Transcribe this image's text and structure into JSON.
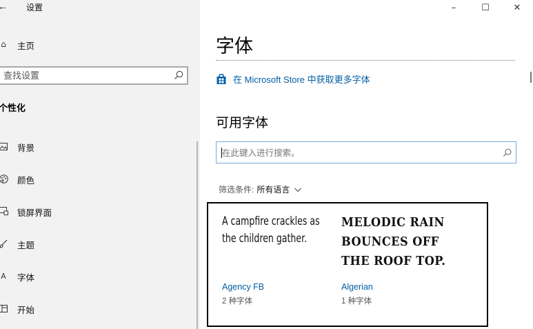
{
  "window": {
    "title": "设置",
    "controls": {
      "minimize": "–",
      "maximize": "☐",
      "close": "✕"
    }
  },
  "sidebar": {
    "home_label": "主页",
    "search_placeholder": "查找设置",
    "section_header": "个性化",
    "items": [
      {
        "label": "背景",
        "icon": "image-icon"
      },
      {
        "label": "颜色",
        "icon": "palette-icon"
      },
      {
        "label": "锁屏界面",
        "icon": "lock-screen-icon"
      },
      {
        "label": "主题",
        "icon": "brush-icon"
      },
      {
        "label": "字体",
        "icon": "font-icon"
      },
      {
        "label": "开始",
        "icon": "start-icon"
      }
    ]
  },
  "main": {
    "page_title": "字体",
    "store_link": "在 Microsoft Store 中获取更多字体",
    "available_fonts_heading": "可用字体",
    "search_placeholder": "在此键入进行搜索。",
    "filter_label": "筛选条件:",
    "filter_value": "所有语言",
    "fonts": [
      {
        "sample": "A campfire crackles as the children gather.",
        "name": "Agency FB",
        "count": "2 种字体"
      },
      {
        "sample": "Melodic rain bounces off the roof top.",
        "name": "Algerian",
        "count": "1 种字体"
      }
    ]
  },
  "colors": {
    "accent_link": "#005ea6",
    "sidebar_background": "#f2f2f2"
  }
}
